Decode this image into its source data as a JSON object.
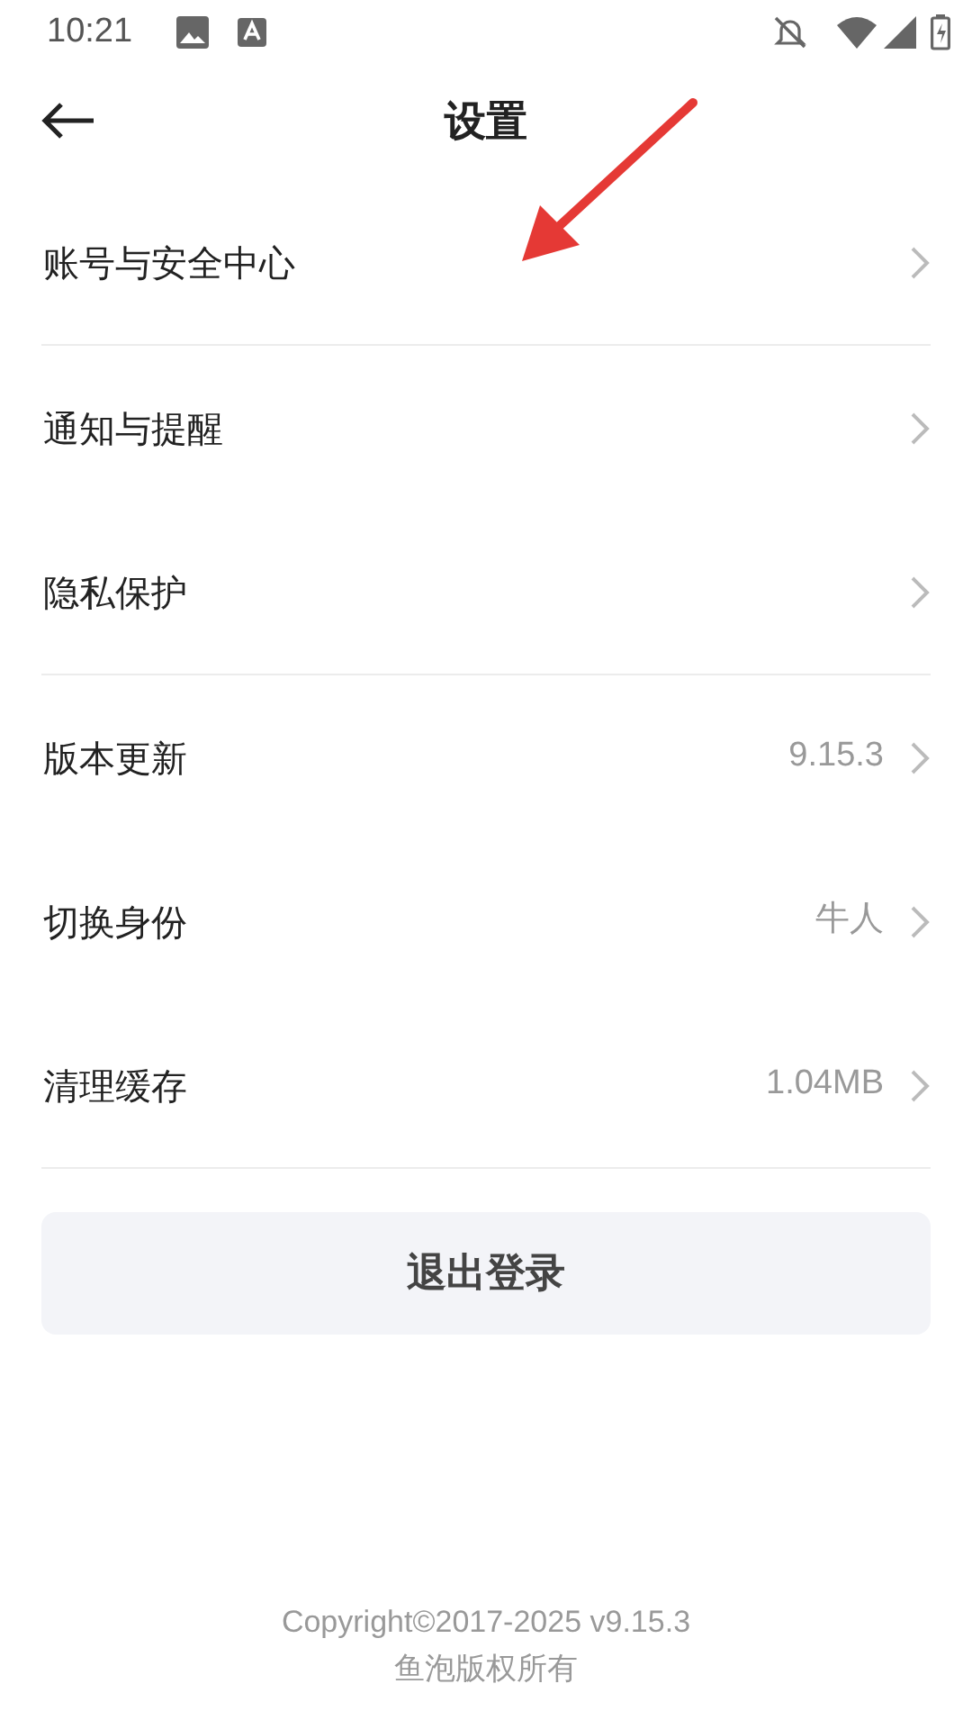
{
  "status_bar": {
    "time": "10:21"
  },
  "header": {
    "title": "设置"
  },
  "groups": [
    {
      "items": [
        {
          "label": "账号与安全中心"
        }
      ]
    },
    {
      "items": [
        {
          "label": "通知与提醒"
        },
        {
          "label": "隐私保护"
        }
      ]
    },
    {
      "items": [
        {
          "label": "版本更新",
          "value": "9.15.3"
        },
        {
          "label": "切换身份",
          "value": "牛人"
        },
        {
          "label": "清理缓存",
          "value": "1.04MB"
        }
      ]
    }
  ],
  "logout_button": {
    "label": "退出登录"
  },
  "footer": {
    "lines": [
      "Copyright©2017-2025 v9.15.3",
      "鱼泡版权所有"
    ]
  }
}
